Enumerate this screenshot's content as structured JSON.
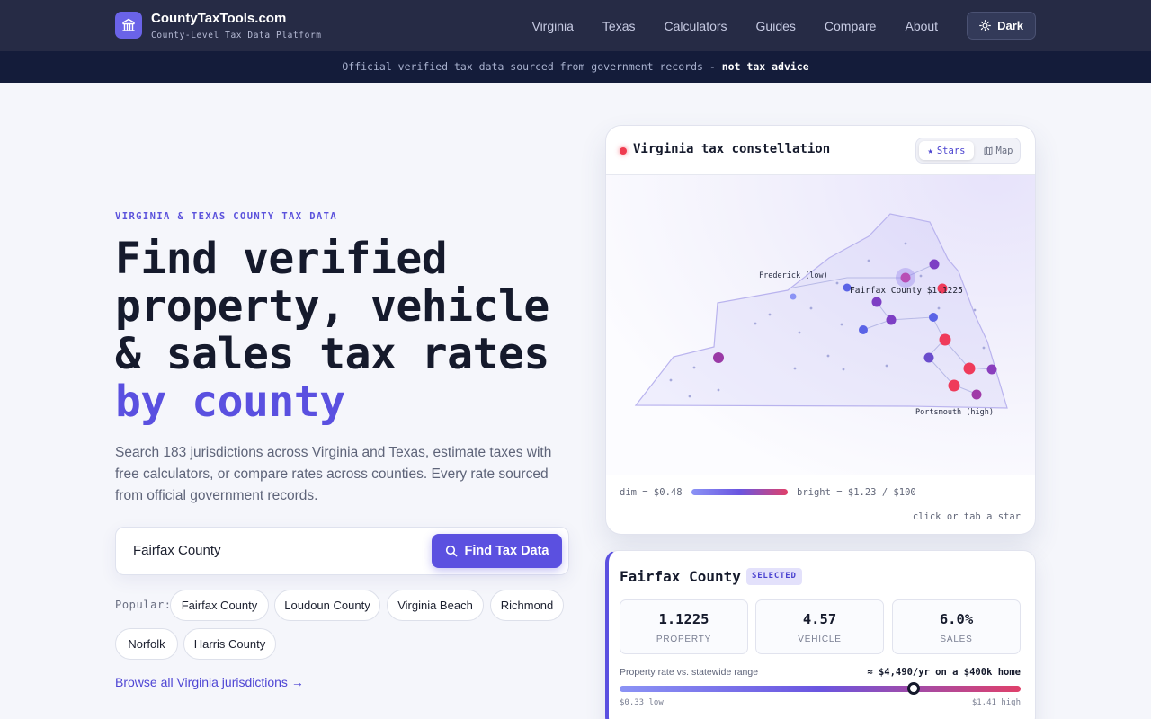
{
  "nav": {
    "brand": "CountyTaxTools.com",
    "tagline": "County-Level Tax Data Platform",
    "logo_icon": "capitol-building-icon",
    "links": [
      "Virginia",
      "Texas",
      "Calculators",
      "Guides",
      "Compare",
      "About"
    ],
    "theme_button": "Dark",
    "theme_icon": "sun-icon"
  },
  "banner": {
    "text": "Official verified tax data sourced from government records - ",
    "emphasis": "not tax advice"
  },
  "hero": {
    "eyebrow": "VIRGINIA & TEXAS COUNTY TAX DATA",
    "headline_lines": [
      "Find verified",
      "property, vehicle",
      "& sales tax rates"
    ],
    "headline_accent": "by county",
    "lead": "Search 183 jurisdictions across Virginia and Texas, estimate taxes with free calculators, or compare rates across counties. Every rate sourced from official government records."
  },
  "search": {
    "value": "Fairfax County",
    "button_label": "Find Tax Data",
    "button_icon": "search-icon"
  },
  "popular": {
    "label": "Popular:",
    "chips": [
      "Fairfax County",
      "Loudoun County",
      "Virginia Beach",
      "Richmond",
      "Norfolk",
      "Harris County"
    ]
  },
  "browse_link": "Browse all Virginia jurisdictions →",
  "constellation": {
    "title": "Virginia tax constellation",
    "toggle": {
      "stars": "Stars",
      "map": "Map",
      "active": "stars"
    },
    "labels": {
      "low": "Frederick (low)",
      "selected": "Fairfax County $1.1225",
      "high": "Portsmouth (high)"
    },
    "legend": {
      "dim": "dim = $0.48",
      "bright": "bright = $1.23 / $100"
    },
    "hint": "click or tab a star",
    "colors": {
      "low": "#8b93f5",
      "mid": "#7d3fc4",
      "high": "#ef3b5a"
    }
  },
  "detail": {
    "county": "Fairfax County",
    "badge": "SELECTED",
    "stats": [
      {
        "value": "1.1225",
        "label": "PROPERTY"
      },
      {
        "value": "4.57",
        "label": "VEHICLE"
      },
      {
        "value": "6.0%",
        "label": "SALES"
      }
    ],
    "range_label": "Property rate vs. statewide range",
    "estimate": "≈ $4,490/yr on a $400k home",
    "range_min": "$0.33 low",
    "range_max": "$1.41 high",
    "range_min_value": 0.33,
    "range_max_value": 1.41,
    "current_value": 1.1225
  }
}
